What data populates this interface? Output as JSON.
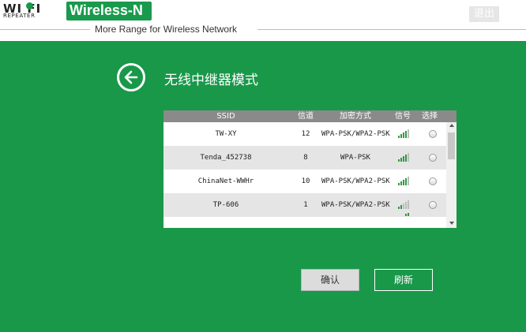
{
  "header": {
    "logo_wifi": "WI  FI",
    "logo_repeater": "REPEATER",
    "brand": "Wireless-N",
    "tagline": "More Range for Wireless Network",
    "logout_label": "退出"
  },
  "main": {
    "title": "无线中继器模式",
    "table": {
      "headers": {
        "ssid": "SSID",
        "channel": "信道",
        "encryption": "加密方式",
        "signal": "信号",
        "select": "选择"
      },
      "rows": [
        {
          "ssid": "TW-XY",
          "channel": "12",
          "encryption": "WPA-PSK/WPA2-PSK",
          "signal_bars": 4
        },
        {
          "ssid": "Tenda_452738",
          "channel": "8",
          "encryption": "WPA-PSK",
          "signal_bars": 4
        },
        {
          "ssid": "ChinaNet-WWHr",
          "channel": "10",
          "encryption": "WPA-PSK/WPA2-PSK",
          "signal_bars": 4
        },
        {
          "ssid": "TP-606",
          "channel": "1",
          "encryption": "WPA-PSK/WPA2-PSK",
          "signal_bars": 2
        }
      ]
    },
    "buttons": {
      "confirm": "确认",
      "refresh": "刷新"
    }
  },
  "colors": {
    "brand_green": "#19984a",
    "signal_green": "#2e9a3f",
    "header_gray": "#8a8a8a"
  },
  "icons": {
    "back": "arrow-left-circle-icon",
    "signal": "signal-bars-icon",
    "logo_dot": "wifi-dot-icon"
  }
}
